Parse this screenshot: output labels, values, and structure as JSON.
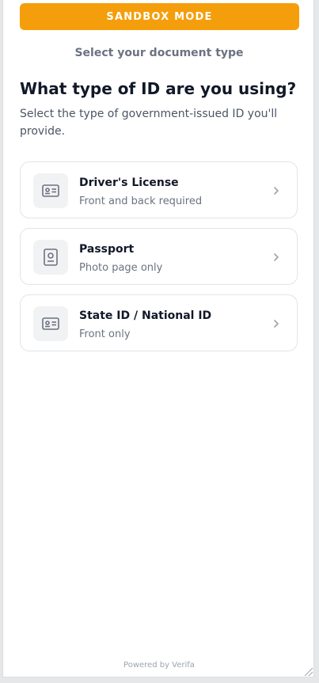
{
  "banner": {
    "label": "SANDBOX MODE"
  },
  "step": {
    "title": "Select your document type"
  },
  "main": {
    "heading": "What type of ID are you using?",
    "subtitle": "Select the type of government-issued ID you'll provide."
  },
  "options": [
    {
      "title": "Driver's License",
      "subtitle": "Front and back required",
      "icon": "id-card-icon"
    },
    {
      "title": "Passport",
      "subtitle": "Photo page only",
      "icon": "passport-icon"
    },
    {
      "title": "State ID / National ID",
      "subtitle": "Front only",
      "icon": "id-card-icon"
    }
  ],
  "footer": {
    "powered_by": "Powered by Verifa"
  },
  "colors": {
    "banner": "#f59e0b",
    "heading": "#111827",
    "muted": "#6b7280"
  }
}
